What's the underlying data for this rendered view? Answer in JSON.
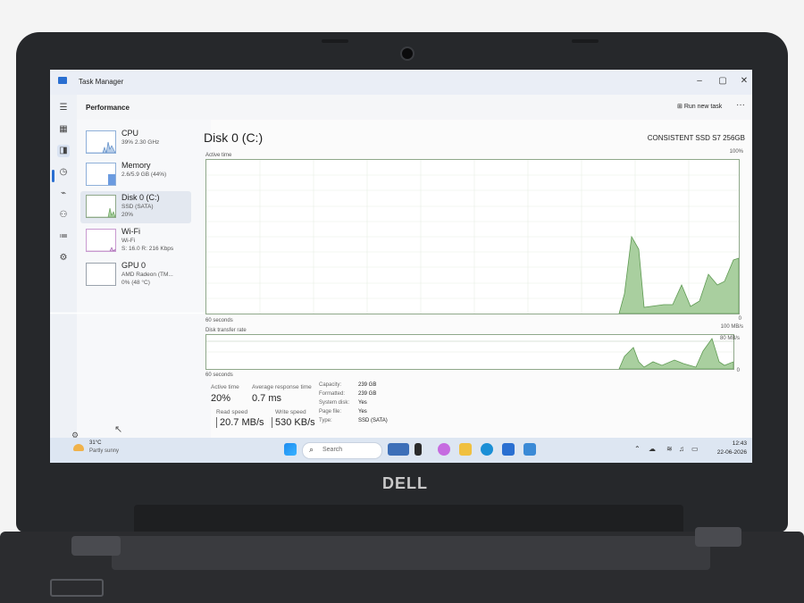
{
  "window": {
    "title": "Task Manager",
    "min": "–",
    "max": "▢",
    "close": "✕"
  },
  "header": {
    "page_title": "Performance",
    "run_task": "Run new task",
    "more": "···"
  },
  "sidebar": {
    "items": [
      {
        "name": "CPU",
        "line1": "39% 2.30 GHz",
        "line2": ""
      },
      {
        "name": "Memory",
        "line1": "2.6/5.9 GB (44%)",
        "line2": ""
      },
      {
        "name": "Disk 0 (C:)",
        "line1": "SSD (SATA)",
        "line2": "20%"
      },
      {
        "name": "Wi-Fi",
        "line1": "Wi-Fi",
        "line2": "S: 16.0  R: 216 Kbps"
      },
      {
        "name": "GPU 0",
        "line1": "AMD Radeon (TM...",
        "line2": "0% (48 °C)"
      }
    ]
  },
  "main": {
    "title": "Disk 0 (C:)",
    "model": "CONSISTENT SSD S7 256GB",
    "active_time_label": "Active time",
    "active_time_max": "100%",
    "active_time_min": "0",
    "seconds_label": "60 seconds",
    "transfer_label": "Disk transfer rate",
    "transfer_max": "100 MB/s",
    "transfer_mid": "80 MB/s",
    "transfer_min": "0",
    "seconds_label_2": "60 seconds",
    "stats": {
      "active_label": "Active time",
      "active_value": "20%",
      "resp_label": "Average response time",
      "resp_value": "0.7 ms",
      "read_label": "Read speed",
      "read_value": "20.7 MB/s",
      "write_label": "Write speed",
      "write_value": "530 KB/s"
    },
    "props": [
      {
        "k": "Capacity:",
        "v": "239 GB"
      },
      {
        "k": "Formatted:",
        "v": "239 GB"
      },
      {
        "k": "System disk:",
        "v": "Yes"
      },
      {
        "k": "Page file:",
        "v": "Yes"
      },
      {
        "k": "Type:",
        "v": "SSD (SATA)"
      }
    ]
  },
  "taskbar": {
    "weather_temp": "31°C",
    "weather_desc": "Partly sunny",
    "search_placeholder": "Search",
    "time": "12:43",
    "date": "22-06-2026"
  },
  "device": {
    "brand": "DELL"
  },
  "colors": {
    "accent": "#2a6fd1",
    "graph_fill": "#a9cf9f",
    "graph_line": "#5e9a52"
  }
}
